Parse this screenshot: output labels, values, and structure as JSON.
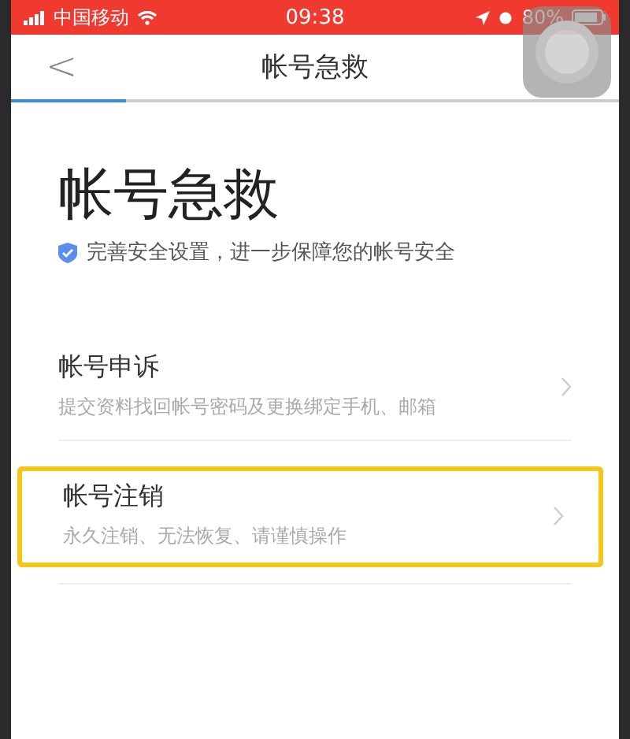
{
  "status_bar": {
    "carrier": "中国移动",
    "time": "09:38",
    "battery": "80%"
  },
  "nav": {
    "back": "<",
    "title": "帐号急救"
  },
  "progress": {
    "level": 0.19
  },
  "header": {
    "title": "帐号急救",
    "subtitle": "完善安全设置，进一步保障您的帐号安全"
  },
  "items": [
    {
      "title": "帐号申诉",
      "description": "提交资料找回帐号密码及更换绑定手机、邮箱",
      "highlighted": false
    },
    {
      "title": "帐号注销",
      "description": "永久注销、无法恢复、请谨慎操作",
      "highlighted": true
    }
  ]
}
